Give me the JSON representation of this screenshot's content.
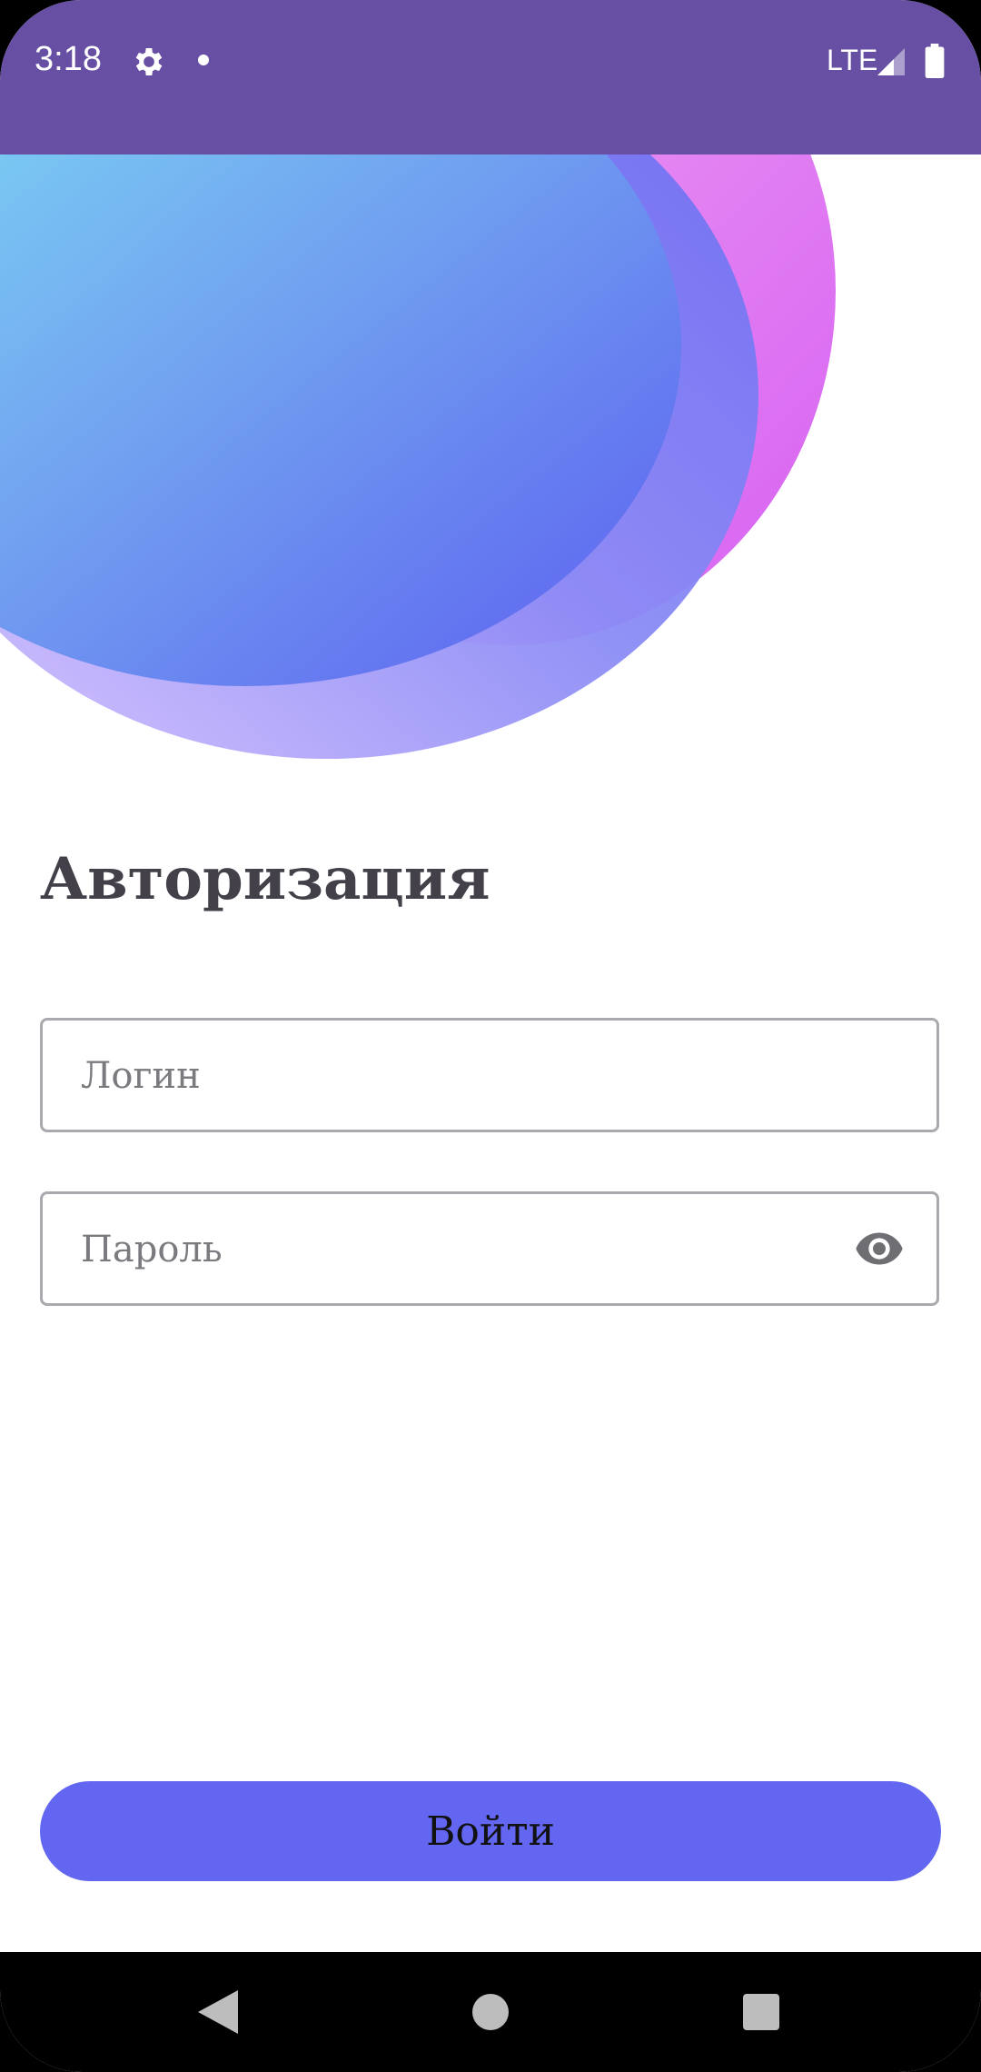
{
  "status_bar": {
    "time": "3:18",
    "network": "LTE",
    "icons": [
      "gear-icon",
      "dot-icon",
      "signal-icon",
      "battery-icon"
    ],
    "color": "#6750A4"
  },
  "login": {
    "title": "Авторизация",
    "login_placeholder": "Логин",
    "password_placeholder": "Пароль",
    "password_toggle_icon": "eye-icon",
    "submit_label": "Войти"
  },
  "colors": {
    "accent": "#6366F1",
    "title": "#43404a"
  },
  "nav_bar": {
    "icons": [
      "back-icon",
      "home-icon",
      "recents-icon"
    ]
  }
}
